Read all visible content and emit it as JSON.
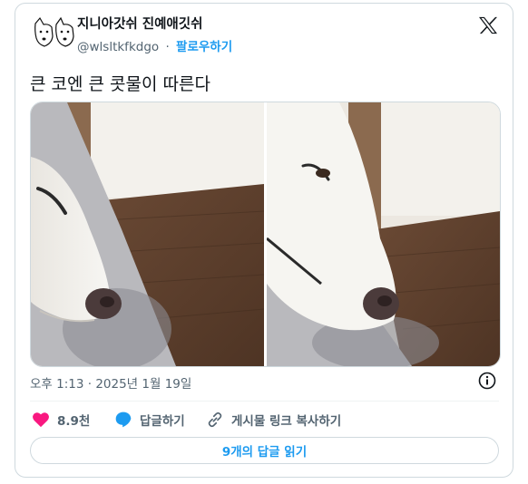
{
  "author": {
    "display_name": "지니아갓쉬 진예애깃쉬",
    "handle": "@wlsltkfkdgo",
    "separator": "·",
    "follow_label": "팔로우하기"
  },
  "tweet": {
    "text": "큰 코엔 큰 콧물이 따른다",
    "timestamp": "오후 1:13 · 2025년 1월 19일"
  },
  "actions": {
    "likes": "8.9천",
    "reply_label": "답글하기",
    "copy_link_label": "게시물 링크 복사하기"
  },
  "read_replies_label": "9개의 답글 읽기",
  "colors": {
    "accent": "#1d9bf0",
    "like": "#f91880",
    "muted": "#536471",
    "border": "#cfd9de"
  },
  "icons": [
    "x-logo-icon",
    "heart-icon",
    "reply-bubble-icon",
    "link-icon",
    "info-icon"
  ]
}
